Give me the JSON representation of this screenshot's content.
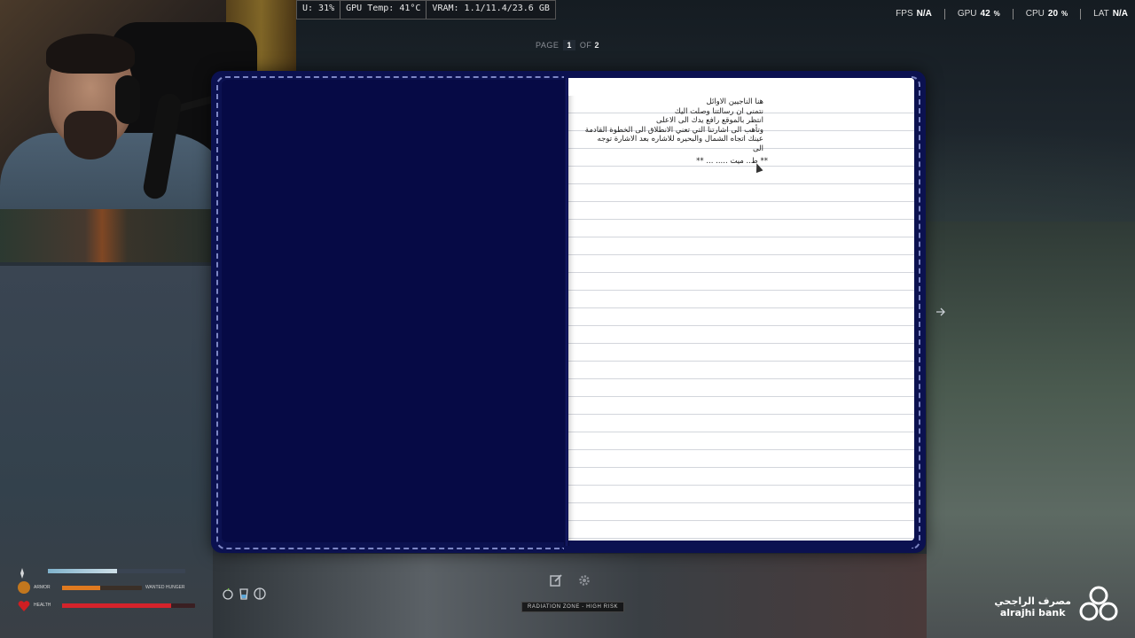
{
  "perf_overlay": {
    "items": [
      "U: 31%",
      "GPU Temp: 41°C",
      "VRAM: 1.1/11.4/23.6 GB"
    ]
  },
  "stats": {
    "fps_label": "FPS",
    "fps_value": "N/A",
    "gpu_label": "GPU",
    "gpu_value": "42",
    "cpu_label": "CPU",
    "cpu_value": "20",
    "lat_label": "LAT",
    "lat_value": "N/A",
    "pct": "%"
  },
  "pager": {
    "page_label": "PAGE",
    "current": "1",
    "of_label": "OF",
    "total": "2"
  },
  "notebook": {
    "lines": [
      "هنا الناجيين الاوائل",
      "نتمنى ان رسالتنا وصلت اليك",
      "انتظر بالموقع رافع يدك الى الاعلى",
      "وتأهب الى اشارتنا التي تعني الانطلاق الى الخطوة القادمة",
      "عينك اتجاه الشمال والبحيره للاشاره بعد الاشارة توجه",
      "الى"
    ],
    "last_line": "** ط.. ميت ..... ... **",
    "cover_color": "#0b1150",
    "stitch_color": "#7d86c4"
  },
  "toolbar": {
    "edit_icon": "edit-icon",
    "settings_icon": "gear-icon"
  },
  "zone": {
    "label": "RADIATION ZONE - HIGH RISK"
  },
  "hud": {
    "armor_label": "ARMOR",
    "health_label": "HEALTH",
    "armor_text": "WANTED HUNGER",
    "icons": [
      "armor-icon",
      "health-icon",
      "water-icon",
      "food-icon",
      "brain-icon"
    ],
    "stamina_level": 0.5,
    "armor_level": 0.48,
    "health_level": 0.82
  },
  "bank": {
    "name_ar": "مصرف الراجحي",
    "name_en": "alrajhi bank"
  }
}
